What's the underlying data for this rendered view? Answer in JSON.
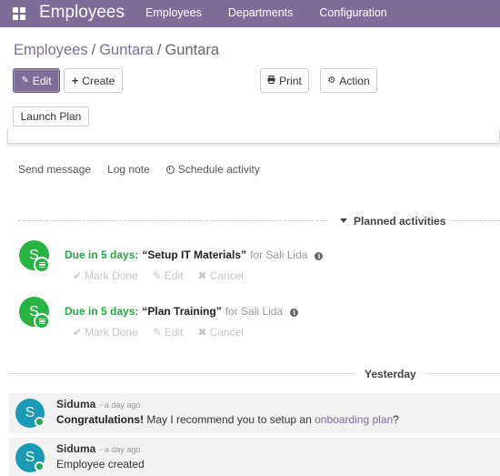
{
  "navbar": {
    "app_title": "Employees",
    "menu": [
      "Employees",
      "Departments",
      "Configuration"
    ],
    "background": "#7c6d99"
  },
  "breadcrumb": {
    "items": [
      "Employees",
      "Guntara"
    ],
    "current": "Guntara",
    "separator": "/"
  },
  "buttons": {
    "edit": "Edit",
    "create": "Create",
    "print": "Print",
    "action": "Action",
    "launch_plan": "Launch Plan"
  },
  "chatter": {
    "send_message": "Send message",
    "log_note": "Log note",
    "schedule_activity": "Schedule activity"
  },
  "planned": {
    "title": "Planned activities",
    "activities": [
      {
        "avatar_letter": "S",
        "due": "Due in 5 days:",
        "summary": "“Setup IT Materials”",
        "for": "for Sali Lida",
        "info_icon": "info-icon",
        "actions": {
          "done": "Mark Done",
          "edit": "Edit",
          "cancel": "Cancel"
        }
      },
      {
        "avatar_letter": "S",
        "due": "Due in 5 days:",
        "summary": "“Plan Training”",
        "for": "for Sali Lida",
        "info_icon": "info-icon",
        "actions": {
          "done": "Mark Done",
          "edit": "Edit",
          "cancel": "Cancel"
        }
      }
    ]
  },
  "separator_label": "Yesterday",
  "messages": [
    {
      "avatar_letter": "S",
      "author": "Siduma",
      "date": "- a day ago",
      "body_bold": "Congratulations!",
      "body_text": " May I recommend you to setup an ",
      "body_link": "onboarding plan",
      "body_end": "?"
    },
    {
      "avatar_letter": "S",
      "author": "Siduma",
      "date": "- a day ago",
      "body_text": "Employee created"
    }
  ],
  "colors": {
    "brand": "#7c6d99",
    "activity_avatar": "#27b443",
    "due_text": "#28a745",
    "message_avatar": "#1a9ab4",
    "online_status": "#24a35a"
  }
}
